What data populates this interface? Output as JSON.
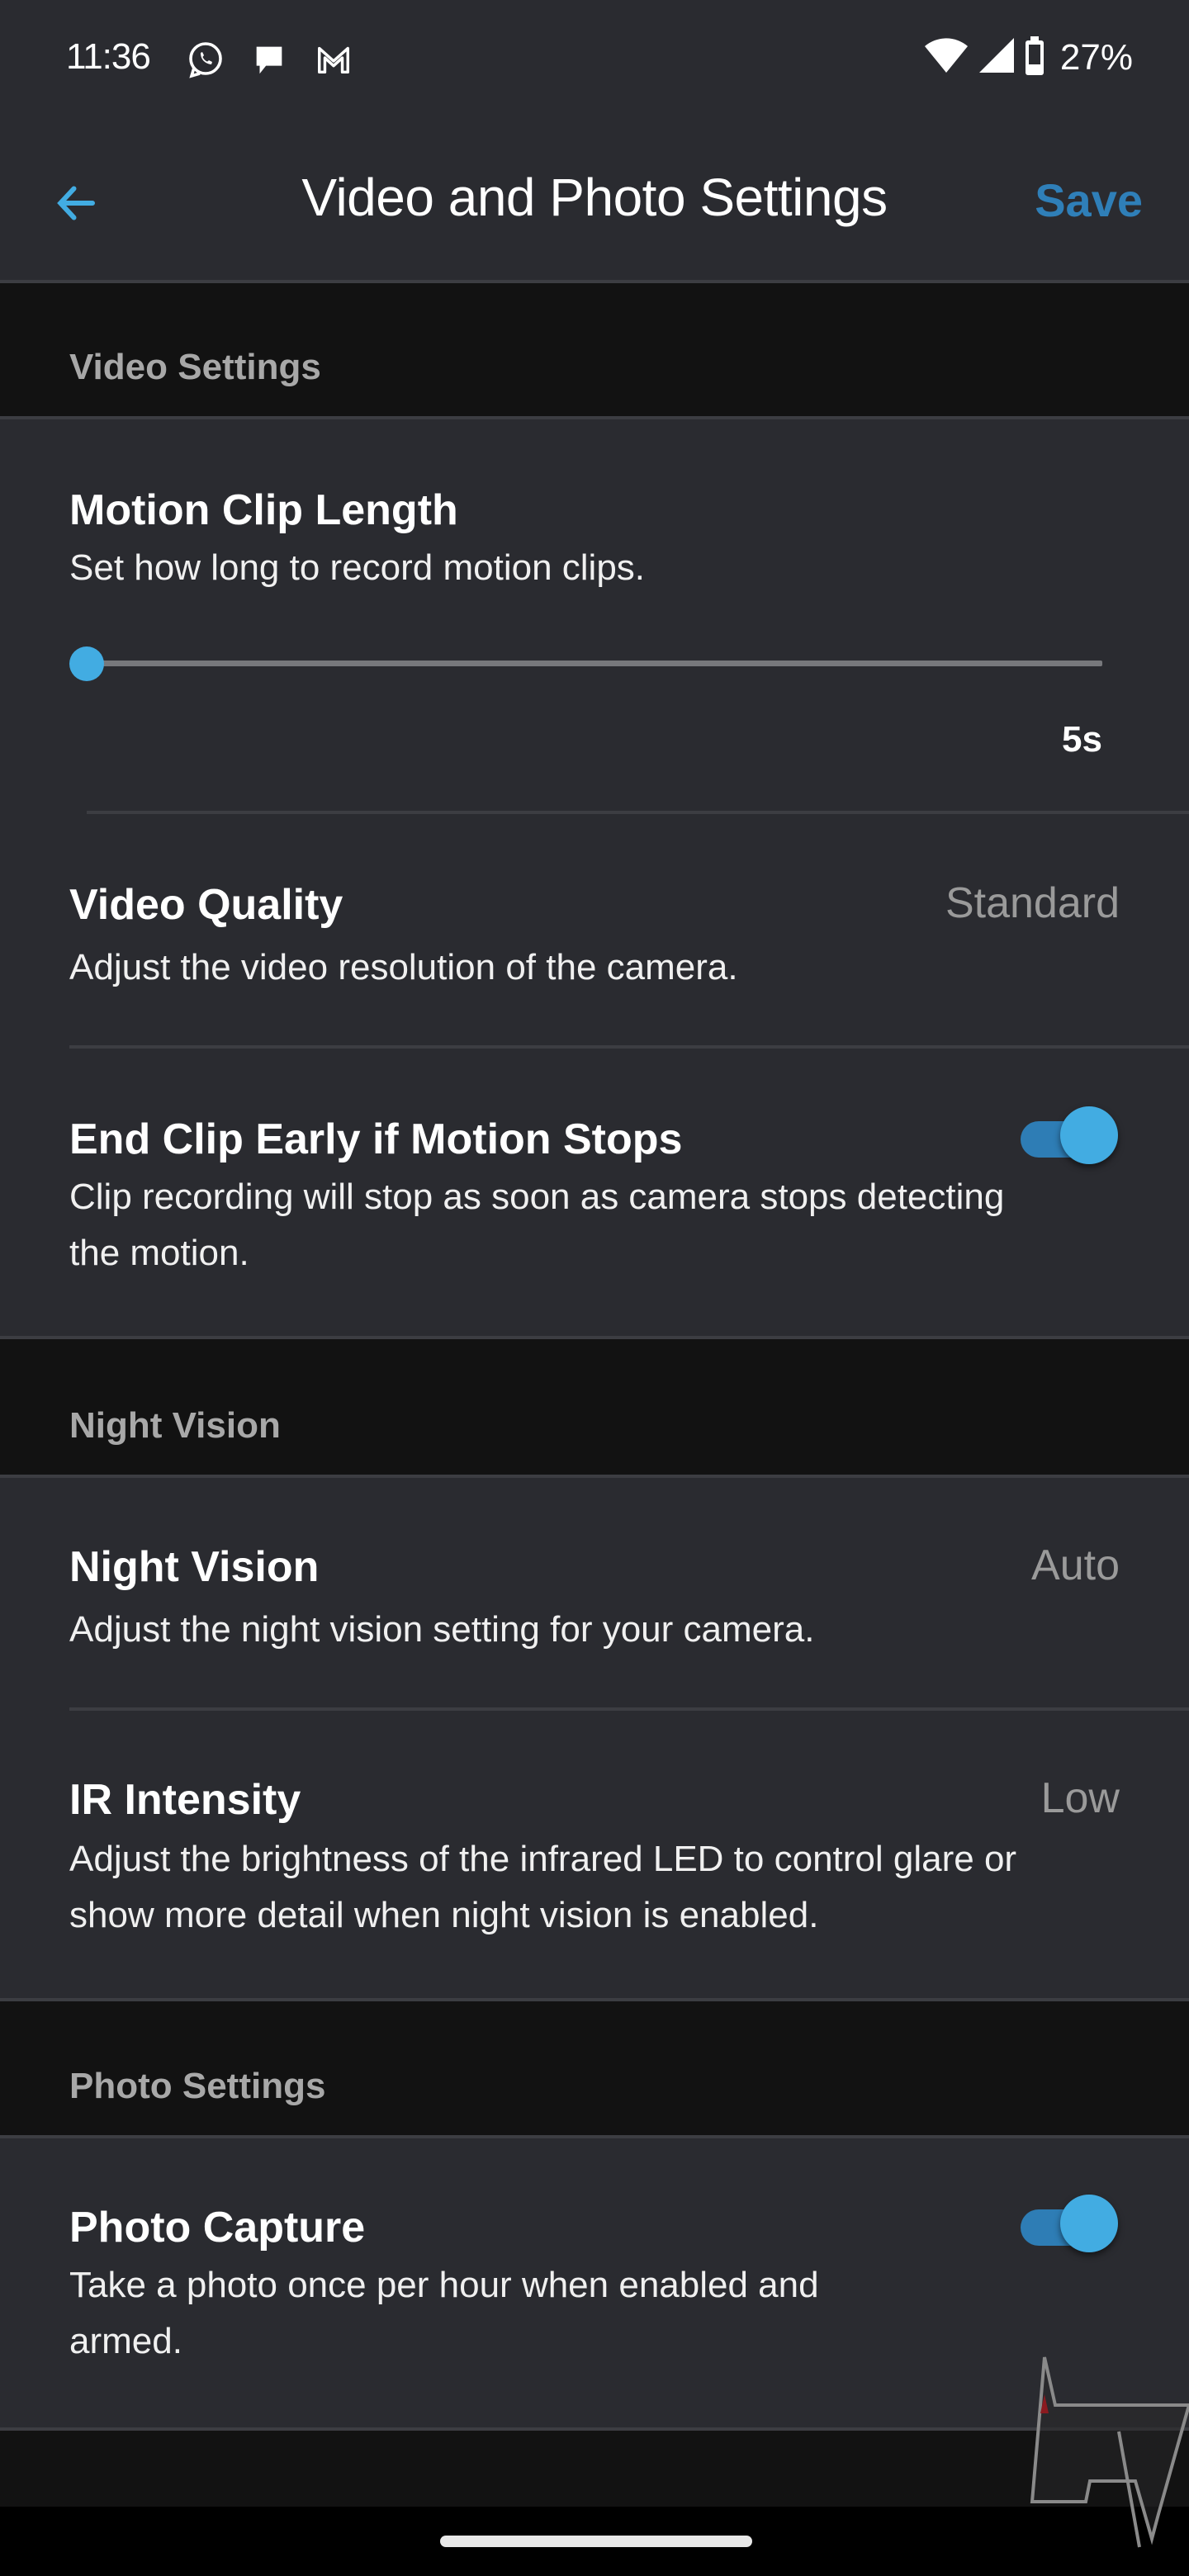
{
  "status_bar": {
    "time": "11:36",
    "notification_icons": [
      "whatsapp-icon",
      "messages-icon",
      "gmail-icon"
    ],
    "system_icons": [
      "wifi-icon",
      "cell-signal-icon",
      "battery-icon"
    ],
    "battery_percent": "27%"
  },
  "app_bar": {
    "back_icon": "arrow-left-icon",
    "title": "Video and Photo Settings",
    "save_label": "Save"
  },
  "colors": {
    "accent": "#42ace2",
    "save_text": "#2f7fb8",
    "toggle_track": "#2e7db5",
    "surface": "#2a2b30",
    "section_bg": "#121212",
    "secondary_text": "#9a9a9a"
  },
  "sections": [
    {
      "header": "Video Settings",
      "items": [
        {
          "title": "Motion Clip Length",
          "description": "Set how long to record motion clips.",
          "control": "slider",
          "slider_value_label": "5s",
          "slider_fraction": 0.0
        },
        {
          "title": "Video Quality",
          "description": "Adjust the video resolution of the camera.",
          "control": "value",
          "value": "Standard"
        },
        {
          "title": "End Clip Early if Motion Stops",
          "description": "Clip recording will stop as soon as camera stops detecting the motion.",
          "control": "toggle",
          "enabled": true
        }
      ]
    },
    {
      "header": "Night Vision",
      "items": [
        {
          "title": "Night Vision",
          "description": "Adjust the night vision setting for your camera.",
          "control": "value",
          "value": "Auto"
        },
        {
          "title": "IR Intensity",
          "description": "Adjust the brightness of the infrared LED to control glare or show more detail when night vision is enabled.",
          "control": "value",
          "value": "Low"
        }
      ]
    },
    {
      "header": "Photo Settings",
      "items": [
        {
          "title": "Photo Capture",
          "description": "Take a photo once per hour when enabled and armed.",
          "control": "toggle",
          "enabled": true
        }
      ]
    }
  ],
  "watermark": "android-police-logo"
}
